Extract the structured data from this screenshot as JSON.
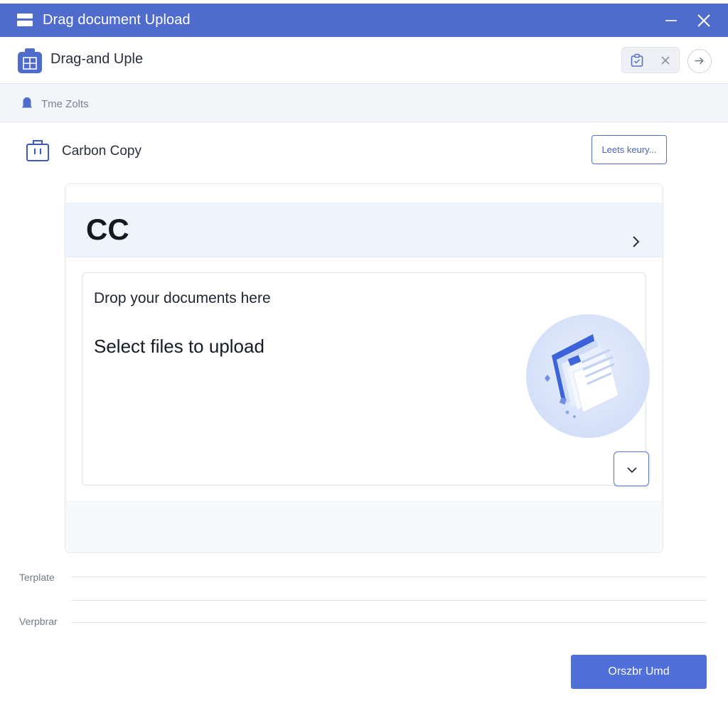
{
  "window": {
    "title": "Drag document Upload",
    "controls": {
      "minimize_icon": "minimize-icon",
      "close_icon": "close-icon"
    }
  },
  "header": {
    "app_name": "Drag-and Uple",
    "tools": [
      "clipboard-icon",
      "close-icon"
    ],
    "forward_icon": "arrow-right-icon"
  },
  "breadcrumb": {
    "icon": "bell-icon",
    "label": "Tme Zolts"
  },
  "section": {
    "icon": "briefcase-icon",
    "title": "Carbon Copy",
    "action_label": "Leets keury..."
  },
  "card": {
    "header_title": "CC",
    "dropzone": {
      "drop_text": "Drop your documents here",
      "select_text": "Select files to upload",
      "illustration": "documents-stack-icon"
    }
  },
  "form": {
    "fields": [
      {
        "label": "Terplate",
        "value": ""
      },
      {
        "label": "Verpbrar",
        "value": ""
      }
    ]
  },
  "footer": {
    "primary_label": "Orszbr Umd"
  },
  "colors": {
    "accent": "#4f6ccc",
    "button": "#4f6fd9",
    "card_header_bg": "#eef3fd",
    "illustration_bg": "#dfe7fb"
  }
}
